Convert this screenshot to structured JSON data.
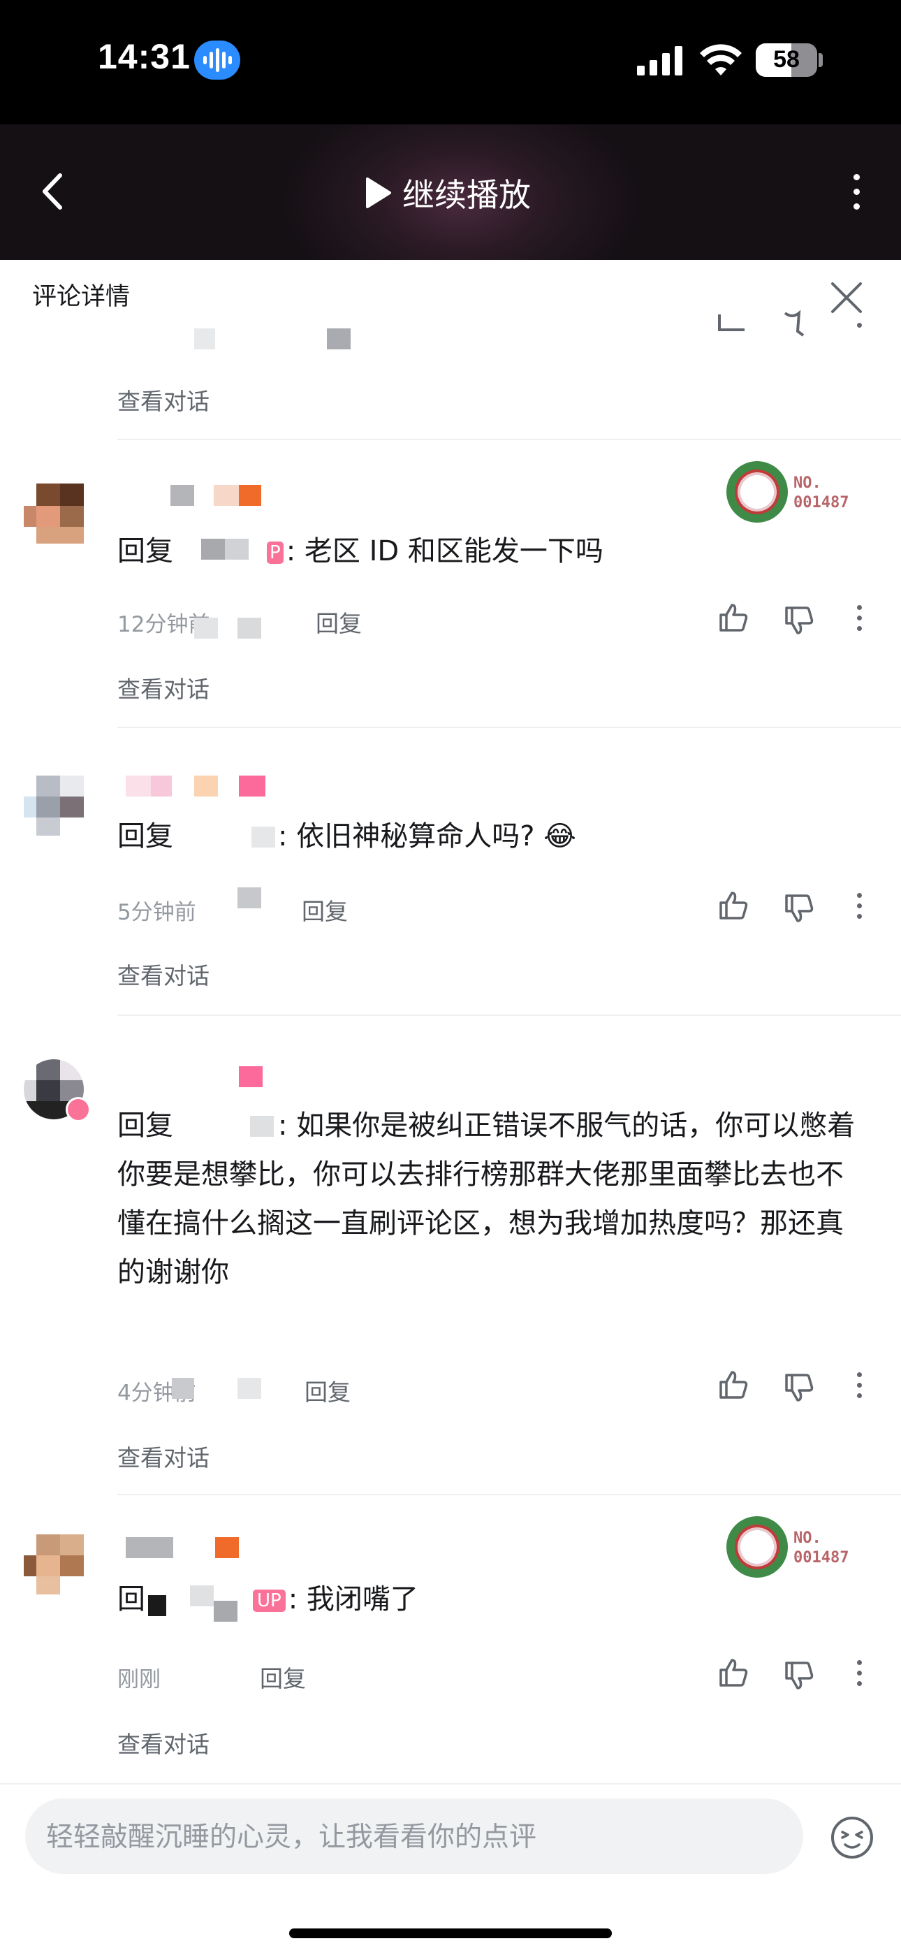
{
  "status_bar": {
    "time": "14:31",
    "battery": "58",
    "battery_level": 0.58
  },
  "header": {
    "continue_label": "继续播放"
  },
  "panel": {
    "title": "评论详情"
  },
  "comments": [
    {
      "view_conversation": "查看对话"
    },
    {
      "reply_prefix": "回复",
      "reply_body": ": 老区 ID 和区能发一下吗",
      "time": "12分钟前",
      "reply_label": "回复",
      "medal_label": "NO.",
      "medal_number": "001487",
      "view_conversation": "查看对话"
    },
    {
      "reply_prefix": "回复",
      "reply_body": ": 依旧神秘算命人吗? 😂",
      "time": "5分钟前",
      "reply_label": "回复",
      "view_conversation": "查看对话"
    },
    {
      "reply_prefix": "回复",
      "reply_body": ": 如果你是被纠正错误不服气的话，你可以憋着",
      "reply_body_2": "你要是想攀比，你可以去排行榜那群大佬那里面攀比去也不懂在搞什么搁这一直刷评论区，想为我增加热度吗？那还真的谢谢你",
      "time": "4分钟前",
      "reply_label": "回复",
      "view_conversation": "查看对话"
    },
    {
      "reply_prefix": "回",
      "up_badge": "UP",
      "reply_body": ": 我闭嘴了",
      "time": "刚刚",
      "reply_label": "回复",
      "medal_label": "NO.",
      "medal_number": "001487",
      "view_conversation": "查看对话"
    }
  ],
  "input": {
    "placeholder": "轻轻敲醒沉睡的心灵，让我看看你的点评"
  },
  "colors": {
    "accent_pink": "#fb7299",
    "text_primary": "#18191c",
    "text_secondary": "#9499a0"
  }
}
